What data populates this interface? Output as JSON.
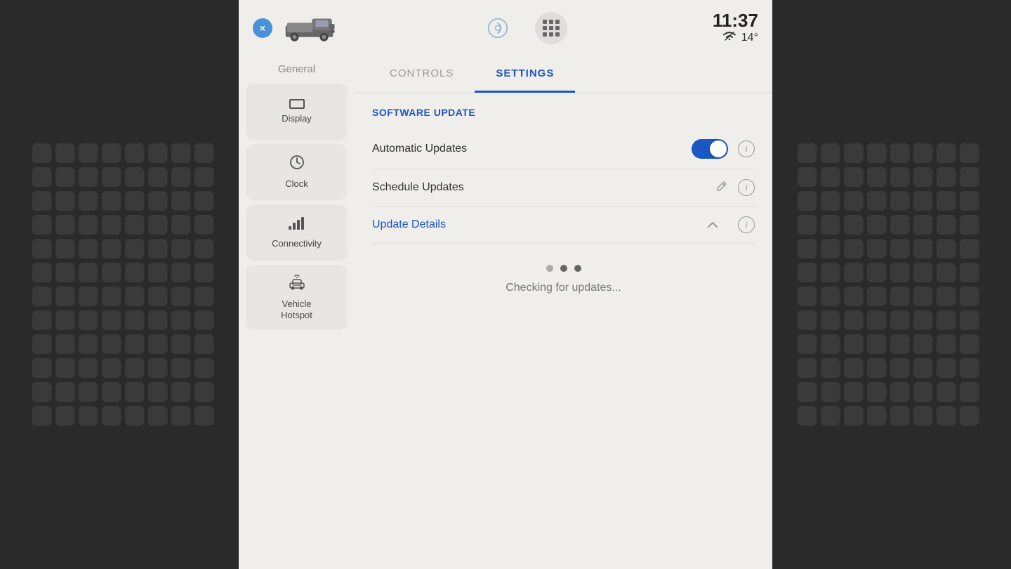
{
  "app": {
    "time": "11:37",
    "temperature": "14°"
  },
  "tabs": [
    {
      "id": "controls",
      "label": "CONTROLS",
      "active": false
    },
    {
      "id": "settings",
      "label": "SETTINGS",
      "active": true
    }
  ],
  "sidebar": {
    "general_label": "General",
    "items": [
      {
        "id": "display",
        "label": "Display",
        "icon": "display"
      },
      {
        "id": "clock",
        "label": "Clock",
        "icon": "clock"
      },
      {
        "id": "connectivity",
        "label": "Connectivity",
        "icon": "connectivity"
      },
      {
        "id": "hotspot",
        "label": "Vehicle Hotspot",
        "icon": "hotspot"
      }
    ]
  },
  "settings": {
    "section_title": "SOFTWARE UPDATE",
    "items": [
      {
        "id": "auto-updates",
        "label": "Automatic Updates",
        "type": "toggle",
        "value": true
      },
      {
        "id": "schedule-updates",
        "label": "Schedule Updates",
        "type": "edit"
      },
      {
        "id": "update-details",
        "label": "Update Details",
        "type": "expandable",
        "expanded": true
      }
    ],
    "checking": {
      "text": "Checking for updates..."
    }
  },
  "buttons": {
    "close": "×",
    "info": "i"
  }
}
